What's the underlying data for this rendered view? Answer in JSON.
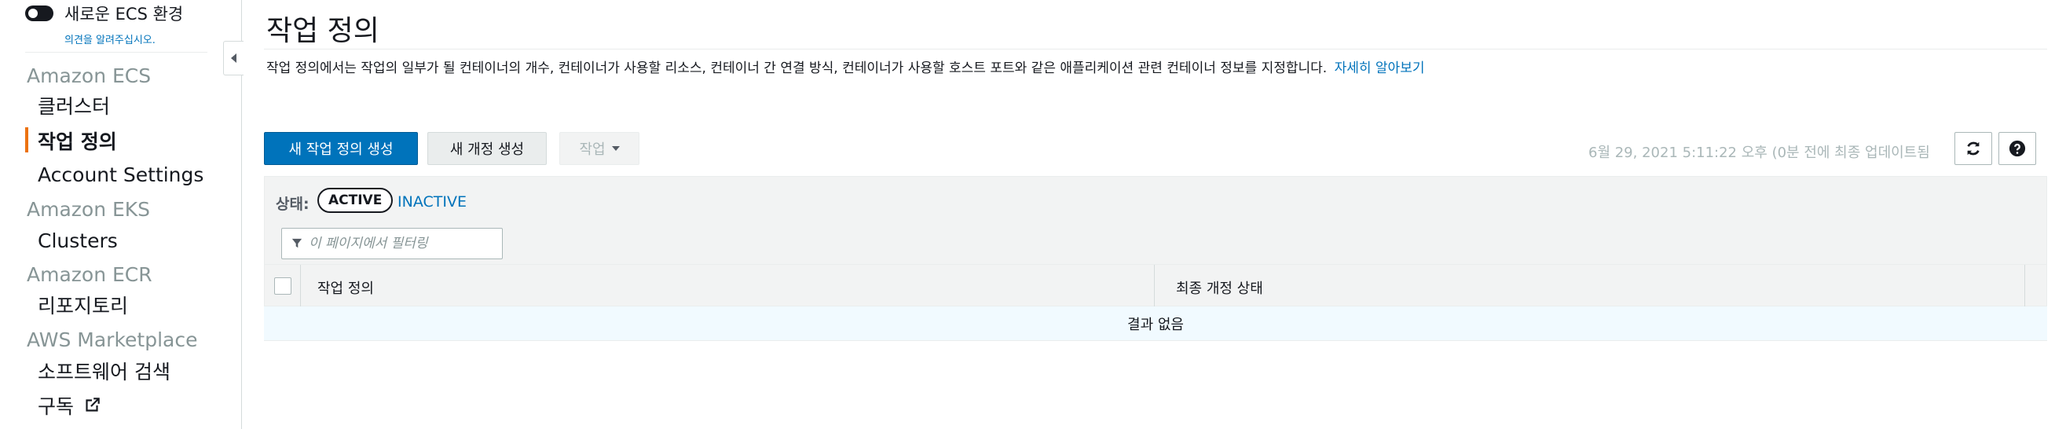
{
  "sidebar": {
    "new_experience_label": "새로운 ECS 환경",
    "feedback_link": "의견을 알려주십시오.",
    "sections": [
      {
        "title": "Amazon ECS",
        "items": [
          "클러스터",
          "작업 정의",
          "Account Settings"
        ]
      },
      {
        "title": "Amazon EKS",
        "items": [
          "Clusters"
        ]
      },
      {
        "title": "Amazon ECR",
        "items": [
          "리포지토리"
        ]
      },
      {
        "title": "AWS Marketplace",
        "items": [
          "소프트웨어 검색",
          "구독"
        ]
      }
    ]
  },
  "main": {
    "title": "작업 정의",
    "description": "작업 정의에서는 작업의 일부가 될 컨테이너의 개수, 컨테이너가 사용할 리소스, 컨테이너 간 연결 방식, 컨테이너가 사용할 호스트 포트와 같은 애플리케이션 관련 컨테이너 정보를 지정합니다.",
    "learn_more": "자세히 알아보기",
    "toolbar": {
      "create_new": "새 작업 정의 생성",
      "create_revision": "새 개정 생성",
      "actions": "작업",
      "timestamp": "6월 29, 2021 5:11:22 오후 (0분 전에 최종 업데이트됨"
    },
    "status": {
      "label": "상태:",
      "active": "ACTIVE",
      "inactive": "INACTIVE"
    },
    "filter": {
      "placeholder": "이 페이지에서 필터링"
    },
    "table": {
      "columns": [
        "작업 정의",
        "최종 개정 상태"
      ],
      "empty_message": "결과 없음"
    }
  },
  "colors": {
    "primary": "#0073bb",
    "active_indicator": "#ec7211",
    "link": "#0073bb"
  }
}
